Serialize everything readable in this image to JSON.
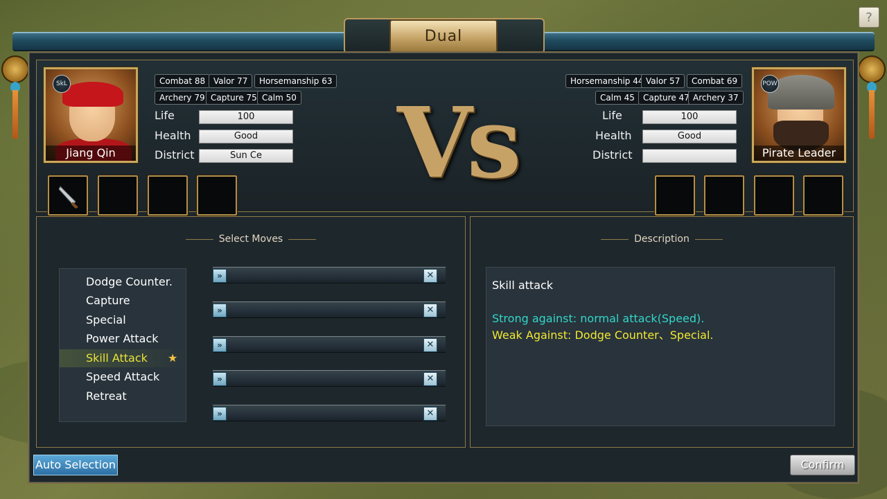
{
  "title": "Dual",
  "help_label": "?",
  "vs_label": "Vs",
  "player": {
    "name": "Jiang Qin",
    "badge": "SkL",
    "stats": {
      "combat": "Combat 88",
      "valor": "Valor 77",
      "horsemanship": "Horsemanship 63",
      "archery": "Archery 79",
      "capture": "Capture 75",
      "calm": "Calm 50"
    },
    "life_label": "Life",
    "life": "100",
    "health_label": "Health",
    "health": "Good",
    "district_label": "District",
    "district": "Sun Ce"
  },
  "enemy": {
    "name": "Pirate Leader",
    "badge": "POW",
    "stats": {
      "horsemanship": "Horsemanship 44",
      "valor": "Valor 57",
      "combat": "Combat 69",
      "calm": "Calm 45",
      "capture": "Capture 47",
      "archery": "Archery 37"
    },
    "life_label": "Life",
    "life": "100",
    "health_label": "Health",
    "health": "Good",
    "district_label": "District",
    "district": ""
  },
  "moves_panel": {
    "title": "Select Moves",
    "moves": [
      "Dodge Counter.",
      "Capture",
      "Special",
      "Power Attack",
      "Skill Attack",
      "Speed Attack",
      "Retreat"
    ],
    "selected_index": 4
  },
  "description_panel": {
    "title": "Description",
    "heading": "Skill attack",
    "strong": "Strong against: normal attack(Speed).",
    "weak": "Weak Against: Dodge Counter、Special.",
    "strong_color": "#33d6c9",
    "weak_color": "#f2e832"
  },
  "buttons": {
    "auto": "Auto Selection",
    "confirm": "Confirm"
  }
}
